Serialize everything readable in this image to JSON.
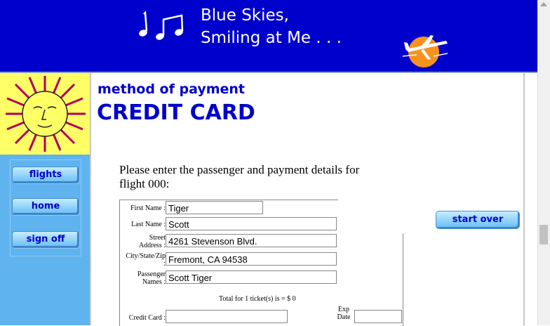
{
  "header": {
    "title_line1": "Blue Skies,",
    "title_line2": "Smiling at Me . . ."
  },
  "nav": {
    "flights": "flights",
    "home": "home",
    "signoff": "sign off"
  },
  "page": {
    "subtitle": "method of payment",
    "title": "CREDIT CARD",
    "intro": "Please enter the passenger and payment details for flight 000:"
  },
  "form": {
    "first_name_label": "First Name :",
    "first_name_value": "Tiger",
    "last_name_label": "Last Name :",
    "last_name_value": "Scott",
    "street_label_1": "Street",
    "street_label_2": "Address :",
    "street_value": "4261 Stevenson Blvd.",
    "csz_label_1": "City/State/Zip",
    "csz_label_2": ":",
    "csz_value": "Fremont, CA 94538",
    "pass_label_1": "Passenger",
    "pass_label_2": "Names :",
    "pass_value": "Scott Tiger",
    "total": "Total for 1 ticket(s) is = $ 0",
    "cc_label": "Credit Card :",
    "cc_value": "",
    "exp_label_1": "Exp",
    "exp_label_2": "Date",
    "exp_value": ""
  },
  "actions": {
    "start_over": "start over"
  },
  "colors": {
    "brand_blue": "#0000cc",
    "sidebar": "#5fb4f0",
    "sun_bg": "#ffff66"
  }
}
